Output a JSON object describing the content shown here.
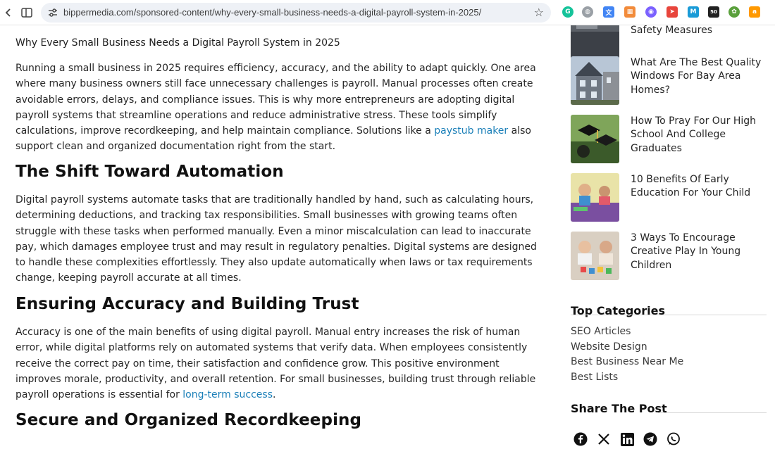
{
  "browser": {
    "url": "bippermedia.com/sponsored-content/why-every-small-business-needs-a-digital-payroll-system-in-2025/",
    "icons": [
      "back-icon",
      "split-view-icon",
      "site-info-icon",
      "bookmark-star-icon"
    ],
    "extensions": [
      {
        "name": "grammarly-extension-icon",
        "color": "#15c39a",
        "glyph": "G"
      },
      {
        "name": "globe-extension-icon",
        "color": "#9aa0a6",
        "glyph": "◍"
      },
      {
        "name": "translate-extension-icon",
        "color": "#4285f4",
        "glyph": "文"
      },
      {
        "name": "grid-extension-icon",
        "color": "#f28b3a",
        "glyph": "▦"
      },
      {
        "name": "circle-extension-icon",
        "color": "#7b61ff",
        "glyph": "◉"
      },
      {
        "name": "arrow-extension-icon",
        "color": "#e8453c",
        "glyph": "➤"
      },
      {
        "name": "m-extension-icon",
        "color": "#1a9bd7",
        "glyph": "M"
      },
      {
        "name": "badge-extension-icon",
        "color": "#222222",
        "glyph": "50"
      },
      {
        "name": "flower-extension-icon",
        "color": "#5aa03c",
        "glyph": "✿"
      },
      {
        "name": "amazon-extension-icon",
        "color": "#ff9900",
        "glyph": "a"
      }
    ]
  },
  "article": {
    "lead_title": "Why Every Small Business Needs a Digital Payroll System in 2025",
    "intro_before_link": "Running a small business in 2025 requires efficiency, accuracy, and the ability to adapt quickly. One area where many business owners still face unnecessary challenges is payroll. Manual processes often create avoidable errors, delays, and compliance issues. This is why more entrepreneurs are adopting digital payroll systems that streamline operations and reduce administrative stress. These tools simplify calculations, improve recordkeeping, and help maintain compliance. Solutions like a ",
    "intro_link": "paystub maker",
    "intro_after_link": " also support clean and organized documentation right from the start.",
    "h2_automation": "The Shift Toward Automation",
    "automation_text": "Digital payroll systems automate tasks that are traditionally handled by hand, such as calculating hours, determining deductions, and tracking tax responsibilities. Small businesses with growing teams often struggle with these tasks when performed manually. Even a minor miscalculation can lead to inaccurate pay, which damages employee trust and may result in regulatory penalties. Digital systems are designed to handle these complexities effortlessly. They also update automatically when laws or tax requirements change, keeping payroll accurate at all times.",
    "h2_accuracy": "Ensuring Accuracy and Building Trust",
    "accuracy_before_link": "Accuracy is one of the main benefits of using digital payroll. Manual entry increases the risk of human error, while digital platforms rely on automated systems that verify data. When employees consistently receive the correct pay on time, their satisfaction and confidence grow. This positive environment improves morale, productivity, and overall retention. For small businesses, building trust through reliable payroll operations is essential for ",
    "accuracy_link": "long-term success",
    "accuracy_after_link": ".",
    "h2_records": "Secure and Organized Recordkeeping"
  },
  "sidebar": {
    "posts": [
      {
        "title": "School Bus Accidents And Safety Measures"
      },
      {
        "title": "What Are The Best Quality Windows For Bay Area Homes?"
      },
      {
        "title": "How To Pray For Our High School And College Graduates"
      },
      {
        "title": "10 Benefits Of Early Education For Your Child"
      },
      {
        "title": "3 Ways To Encourage Creative Play In Young Children"
      }
    ],
    "top_categories_title": "Top Categories",
    "categories": [
      "SEO Articles",
      "Website Design",
      "Best Business Near Me",
      "Best Lists"
    ],
    "share_title": "Share The Post",
    "share_icons": [
      "facebook-icon",
      "x-icon",
      "linkedin-icon",
      "telegram-icon",
      "whatsapp-icon"
    ]
  },
  "colors": {
    "link": "#1a7fb8",
    "heading": "#111111",
    "text": "#262626"
  }
}
